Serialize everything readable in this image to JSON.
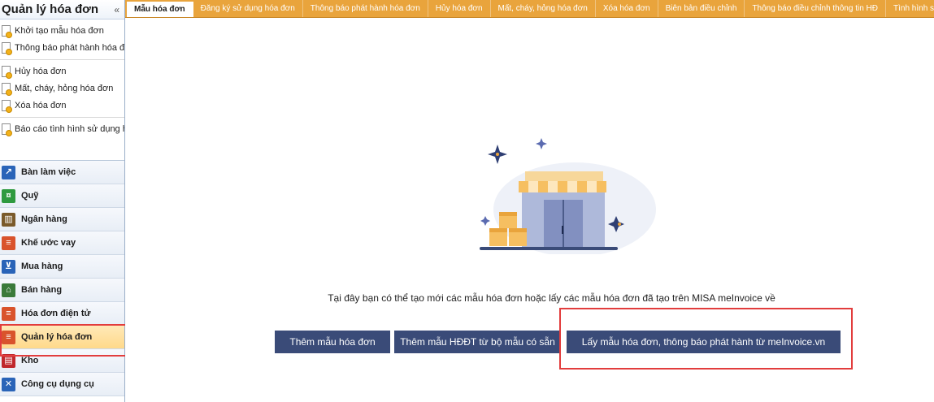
{
  "sidebar": {
    "title": "Quản lý hóa đơn",
    "collapse_glyph": "«",
    "task_groups": [
      [
        "Khởi tạo mẫu hóa đơn",
        "Thông báo phát hành hóa đ..."
      ],
      [
        "Hủy hóa đơn",
        "Mất, cháy, hỏng hóa đơn",
        "Xóa hóa đơn"
      ],
      [
        "Báo cáo tình hình sử dụng h..."
      ]
    ],
    "modules": [
      {
        "label": "Bàn làm việc",
        "icon": "chart-icon",
        "color": "#2a64b8"
      },
      {
        "label": "Quỹ",
        "icon": "cash-icon",
        "color": "#2f9a3f"
      },
      {
        "label": "Ngân hàng",
        "icon": "bank-icon",
        "color": "#7a5a2a"
      },
      {
        "label": "Khế ước vay",
        "icon": "contract-icon",
        "color": "#d9532c"
      },
      {
        "label": "Mua hàng",
        "icon": "cart-icon",
        "color": "#2a64b8"
      },
      {
        "label": "Bán hàng",
        "icon": "shop-icon",
        "color": "#3a7a3a"
      },
      {
        "label": "Hóa đơn điện tử",
        "icon": "einvoice-icon",
        "color": "#d9532c"
      },
      {
        "label": "Quản lý hóa đơn",
        "icon": "invoice-icon",
        "color": "#d9532c",
        "active": true
      },
      {
        "label": "Kho",
        "icon": "warehouse-icon",
        "color": "#c0282d"
      },
      {
        "label": "Công cụ dụng cụ",
        "icon": "tools-icon",
        "color": "#2a64b8"
      }
    ]
  },
  "tabs": [
    {
      "label": "Mẫu hóa đơn",
      "active": true
    },
    {
      "label": "Đăng ký sử dụng hóa đơn"
    },
    {
      "label": "Thông báo phát hành hóa đơn"
    },
    {
      "label": "Hủy hóa đơn"
    },
    {
      "label": "Mất, cháy, hỏng hóa đơn"
    },
    {
      "label": "Xóa hóa đơn"
    },
    {
      "label": "Biên bản điều chỉnh"
    },
    {
      "label": "Thông báo điều chỉnh thông tin HĐ"
    },
    {
      "label": "Tình hình sử dụng"
    }
  ],
  "main": {
    "message": "Tại đây bạn có thể tạo mới các mẫu hóa đơn hoặc lấy các mẫu hóa đơn đã tạo trên MISA meInvoice về",
    "buttons": {
      "add_template": "Thêm mẫu hóa đơn",
      "add_from_set": "Thêm mẫu HĐĐT từ bộ mẫu có sẵn",
      "fetch_from_meinvoice": "Lấy mẫu hóa đơn, thông báo phát hành từ meInvoice.vn"
    }
  },
  "colors": {
    "tab_bar": "#e9a43c",
    "button": "#3a4b78",
    "highlight": "#e23d3d",
    "active_module": "#ffd98a"
  }
}
